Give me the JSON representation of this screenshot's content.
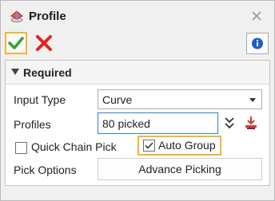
{
  "window": {
    "title": "Profile",
    "icons": {
      "app": "profile-app-icon",
      "close": "close-icon"
    }
  },
  "toolbar": {
    "ok": {
      "icon": "checkmark-icon",
      "color": "#2fa52f"
    },
    "cancel": {
      "icon": "red-x-icon",
      "color": "#e02424"
    },
    "info": {
      "icon": "info-icon",
      "color": "#1f5fbf"
    }
  },
  "section": {
    "title": "Required",
    "fields": {
      "input_type": {
        "label": "Input Type",
        "value": "Curve"
      },
      "profiles": {
        "label": "Profiles",
        "value": "80 picked"
      },
      "quick_chain_pick": {
        "label": "Quick Chain Pick",
        "checked": false
      },
      "auto_group": {
        "label": "Auto Group",
        "checked": true
      },
      "pick_options": {
        "label": "Pick Options",
        "button_label": "Advance Picking"
      }
    }
  },
  "colors": {
    "highlight": "#f0b43a",
    "focus_border": "#2f7fd8"
  }
}
